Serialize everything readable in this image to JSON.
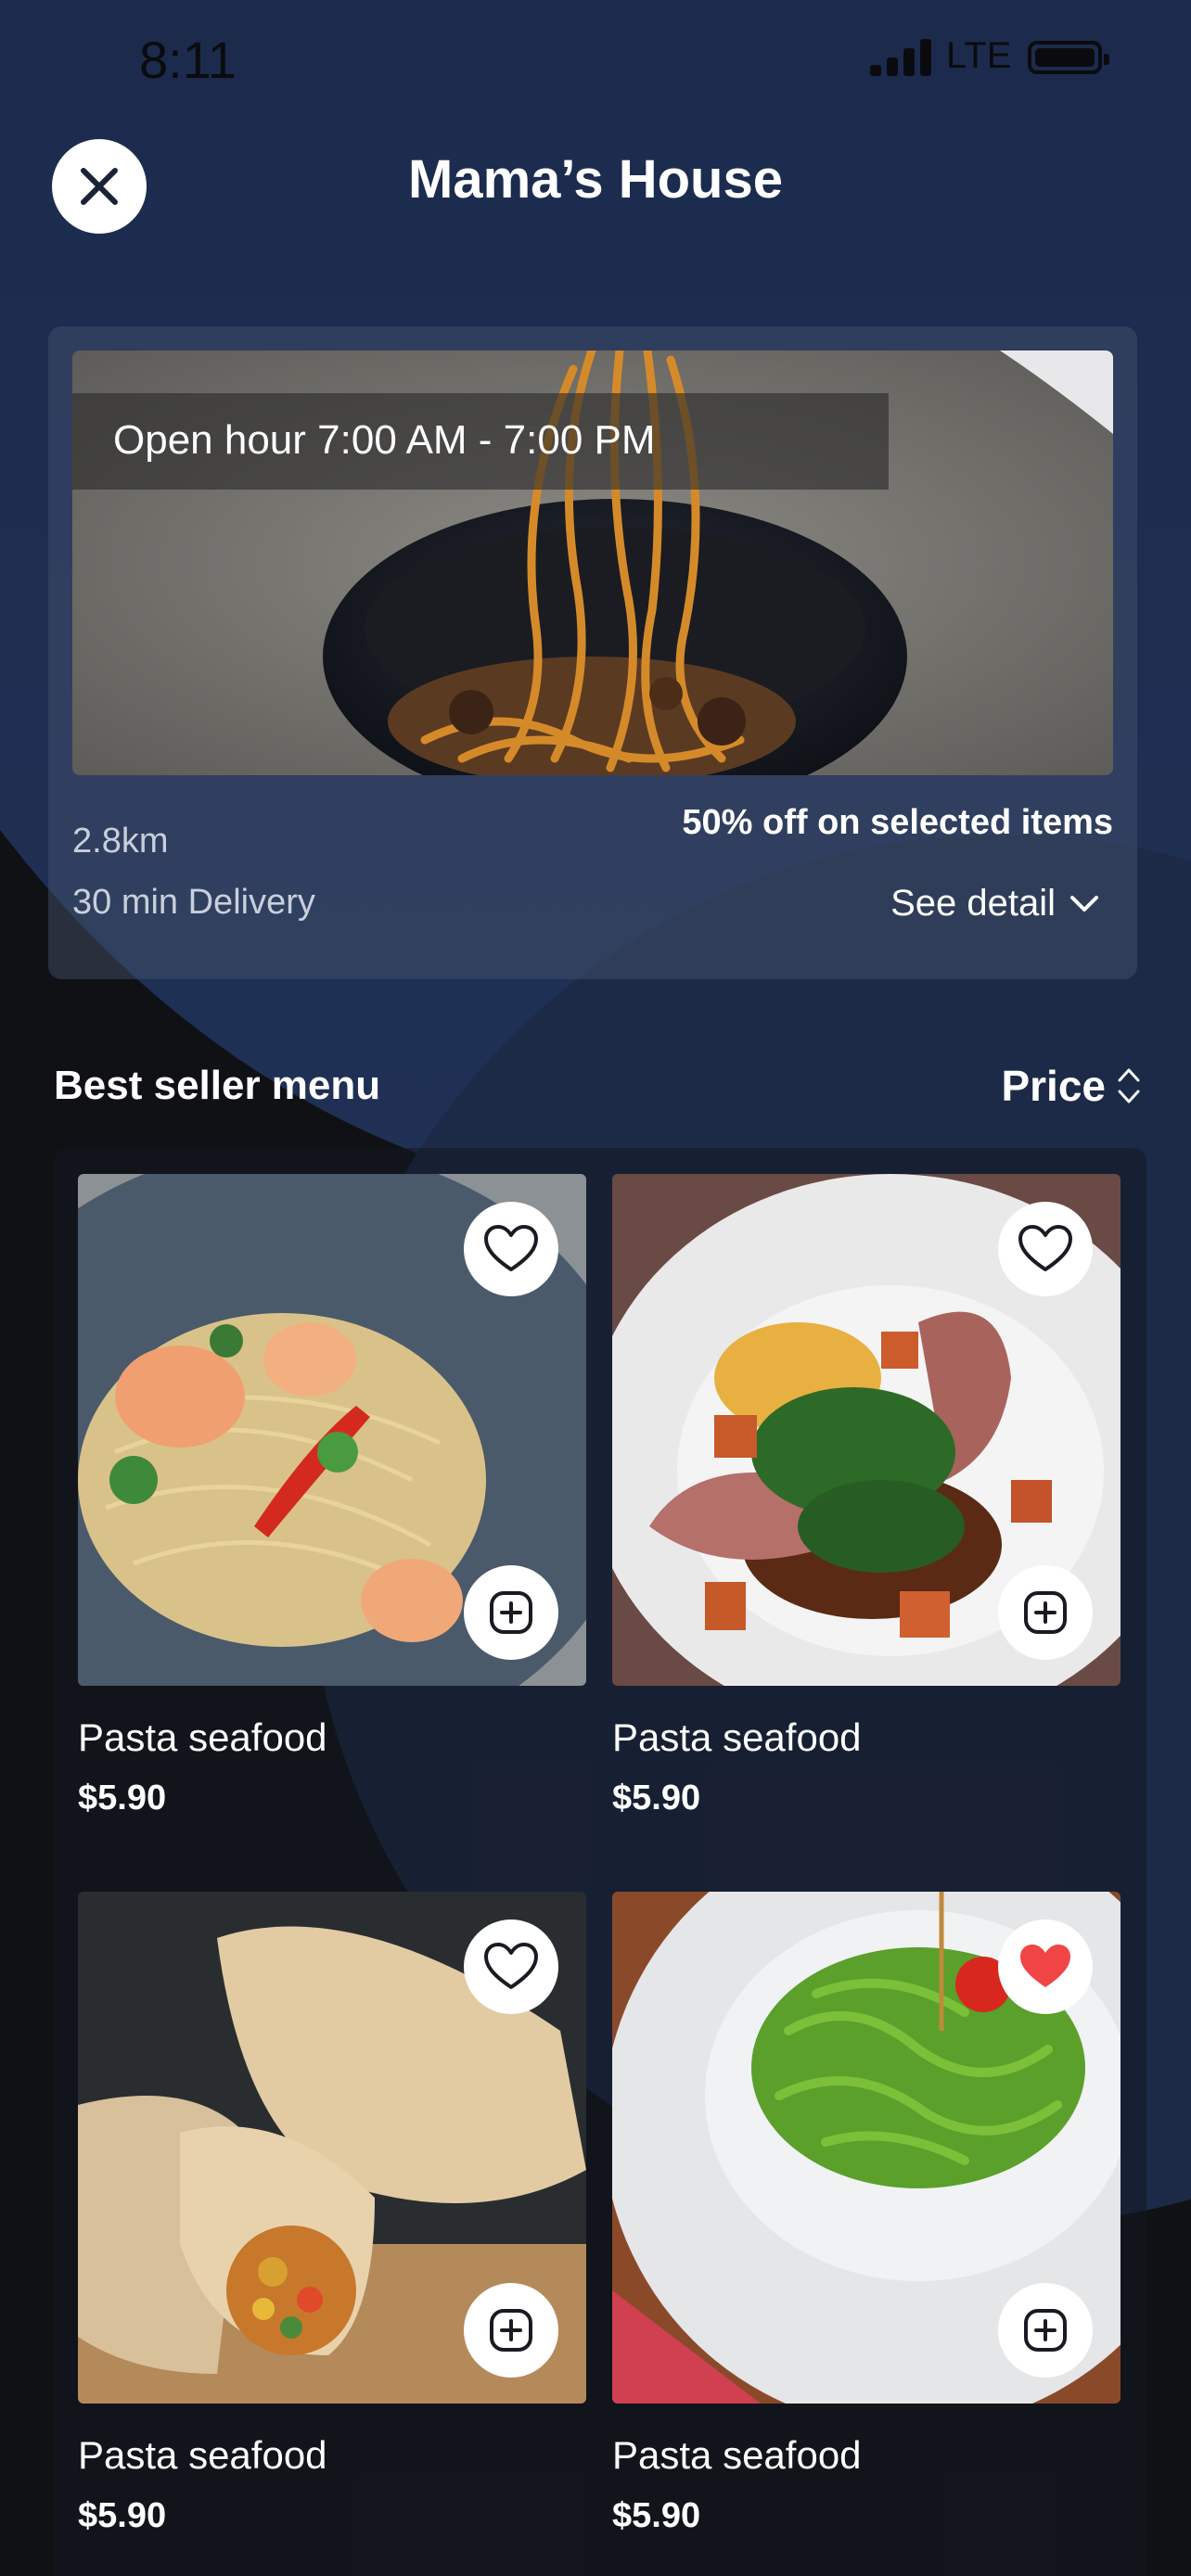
{
  "status_bar": {
    "time": "8:11",
    "network": "LTE"
  },
  "header": {
    "title": "Mama’s House",
    "close_icon": "close-icon"
  },
  "restaurant": {
    "open_hours": "Open hour 7:00 AM - 7:00 PM",
    "distance": "2.8km",
    "delivery_time": "30 min Delivery",
    "promo": "50% off on selected items",
    "see_detail": "See detail"
  },
  "section": {
    "title": "Best seller menu",
    "sort_label": "Price"
  },
  "menu": {
    "items": [
      {
        "name": "Pasta seafood",
        "price": "$5.90",
        "favorited": false
      },
      {
        "name": "Pasta seafood",
        "price": "$5.90",
        "favorited": false
      },
      {
        "name": "Pasta seafood",
        "price": "$5.90",
        "favorited": false
      },
      {
        "name": "Pasta seafood",
        "price": "$5.90",
        "favorited": true
      }
    ]
  },
  "colors": {
    "accent_heart": "#f04545",
    "background_blue": "#1c2b4d",
    "card": "#3b4560"
  }
}
